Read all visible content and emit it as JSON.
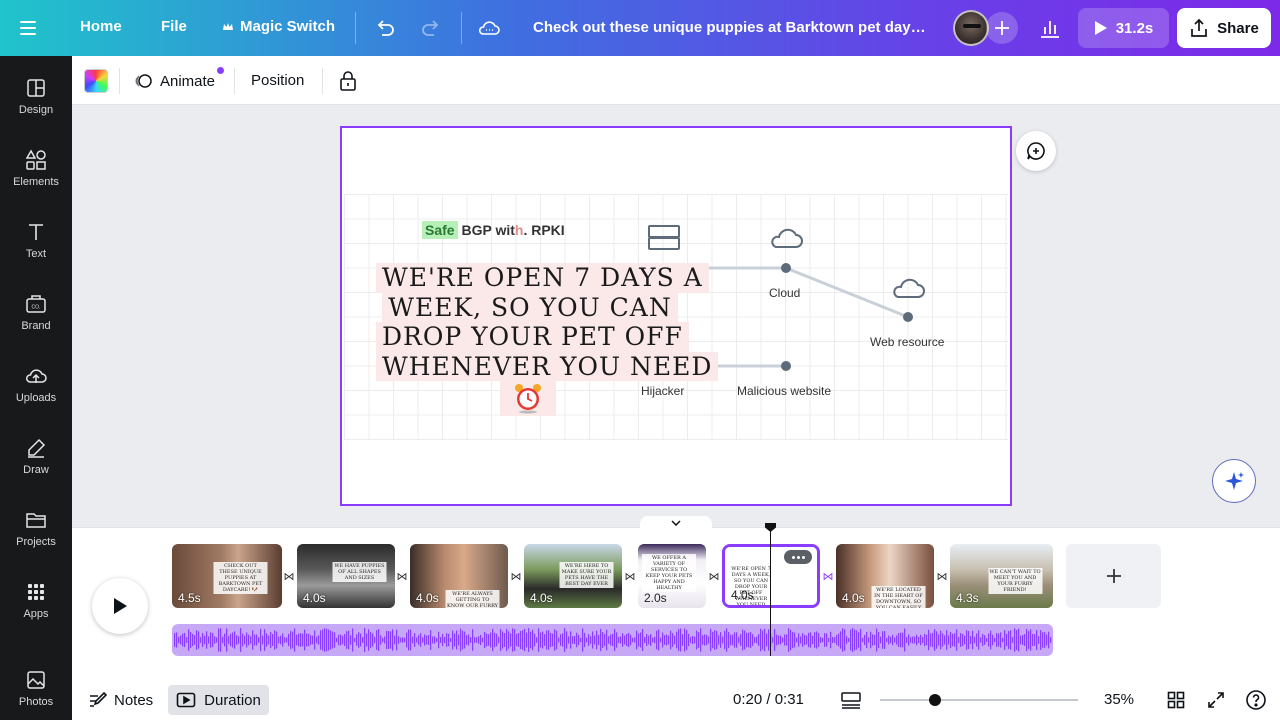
{
  "topbar": {
    "home": "Home",
    "file": "File",
    "magic_switch": "Magic Switch",
    "title": "Check out these unique puppies at Barktown pet daycar...",
    "play_duration": "31.2s",
    "share": "Share"
  },
  "sidebar": {
    "items": [
      {
        "label": "Design",
        "icon": "design-icon"
      },
      {
        "label": "Elements",
        "icon": "elements-icon"
      },
      {
        "label": "Text",
        "icon": "text-icon"
      },
      {
        "label": "Brand",
        "icon": "brand-icon"
      },
      {
        "label": "Uploads",
        "icon": "uploads-icon"
      },
      {
        "label": "Draw",
        "icon": "draw-icon"
      },
      {
        "label": "Projects",
        "icon": "projects-icon"
      },
      {
        "label": "Apps",
        "icon": "apps-icon"
      },
      {
        "label": "Photos",
        "icon": "photos-icon"
      }
    ]
  },
  "toolbar": {
    "animate": "Animate",
    "position": "Position"
  },
  "canvas": {
    "safe_highlight": "Safe",
    "safe_rest": "BGP wit",
    "safe_tail": ". RPKI",
    "cloud": "Cloud",
    "web_resource": "Web resource",
    "hijacker": "Hijacker",
    "malicious_website": "Malicious website",
    "callout_lines": [
      "WE'RE OPEN 7 DAYS A",
      "WEEK, SO YOU CAN",
      "DROP YOUR PET OFF",
      "WHENEVER YOU NEED"
    ]
  },
  "timeline": {
    "clips": [
      {
        "duration": "4.5s",
        "caption": "CHECK OUT THESE UNIQUE PUPPIES AT BARKTOWN PET DAYCARE! 🐶"
      },
      {
        "duration": "4.0s",
        "caption": "WE HAVE PUPPIES OF ALL SHAPES AND SIZES"
      },
      {
        "duration": "4.0s",
        "caption": "WE'RE ALWAYS GETTING TO KNOW OUR FURRY FRIENDS"
      },
      {
        "duration": "4.0s",
        "caption": "WE'RE HERE TO MAKE SURE YOUR PETS HAVE THE BEST DAY EVER"
      },
      {
        "duration": "2.0s",
        "caption": "WE OFFER A VARIETY OF SERVICES TO KEEP YOUR PETS HAPPY AND HEALTHY"
      },
      {
        "duration": "4.0s",
        "caption": "WE'RE OPEN 7 DAYS A WEEK, SO YOU CAN DROP YOUR PET OFF WHENEVER YOU NEED"
      },
      {
        "duration": "4.0s",
        "caption": "WE'RE LOCATED IN THE HEART OF DOWNTOWN, SO YOU CAN EASILY ACCESS US"
      },
      {
        "duration": "4.3s",
        "caption": "WE CAN'T WAIT TO MEET YOU AND YOUR FURRY FRIEND!"
      }
    ]
  },
  "bottombar": {
    "notes": "Notes",
    "duration": "Duration",
    "time": "0:20 / 0:31",
    "zoom": "35%",
    "zoom_level": 0.28
  },
  "colors": {
    "accent": "#8b3dff",
    "sidebar_bg": "#18191b"
  }
}
